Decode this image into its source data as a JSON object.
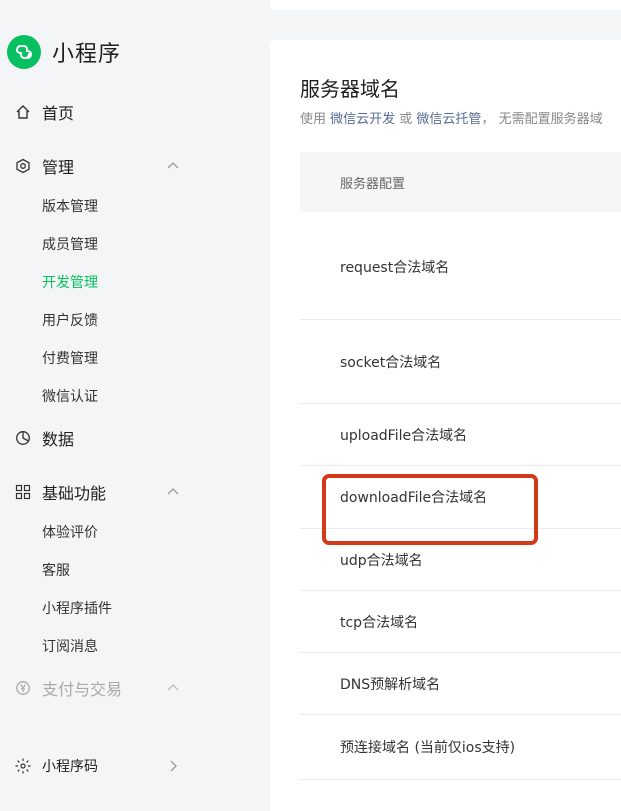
{
  "brand": {
    "name": "小程序",
    "logo_icon": "mini-program-logo-icon",
    "logo_color": "#07c160"
  },
  "sidebar": {
    "home": {
      "label": "首页",
      "icon": "home-icon"
    },
    "manage": {
      "label": "管理",
      "icon": "settings-hexagon-icon",
      "items": [
        {
          "label": "版本管理"
        },
        {
          "label": "成员管理"
        },
        {
          "label": "开发管理",
          "active": true
        },
        {
          "label": "用户反馈"
        },
        {
          "label": "付费管理"
        },
        {
          "label": "微信认证"
        }
      ]
    },
    "data": {
      "label": "数据",
      "icon": "pie-chart-icon"
    },
    "basic": {
      "label": "基础功能",
      "icon": "grid-icon",
      "items": [
        {
          "label": "体验评价"
        },
        {
          "label": "客服"
        },
        {
          "label": "小程序插件"
        },
        {
          "label": "订阅消息"
        }
      ]
    },
    "payment": {
      "label": "支付与交易",
      "icon": "yen-circle-icon",
      "disabled": true
    },
    "qrcode": {
      "label": "小程序码",
      "icon": "qrcode-icon"
    }
  },
  "main": {
    "title": "服务器域名",
    "description": {
      "prefix": "使用 ",
      "link1": "微信云开发",
      "middle": " 或 ",
      "link2": "微信云托管",
      "suffix": "， 无需配置服务器域"
    },
    "table_header": "服务器配置",
    "rows": [
      {
        "label": "request合法域名"
      },
      {
        "label": "socket合法域名"
      },
      {
        "label": "uploadFile合法域名"
      },
      {
        "label": "downloadFile合法域名",
        "highlighted": true
      },
      {
        "label": "udp合法域名"
      },
      {
        "label": "tcp合法域名"
      },
      {
        "label": "DNS预解析域名"
      },
      {
        "label": "预连接域名 (当前仅ios支持)"
      }
    ]
  },
  "colors": {
    "accent": "#07c160",
    "highlight_border": "#d23a1a",
    "link": "#576b95"
  }
}
